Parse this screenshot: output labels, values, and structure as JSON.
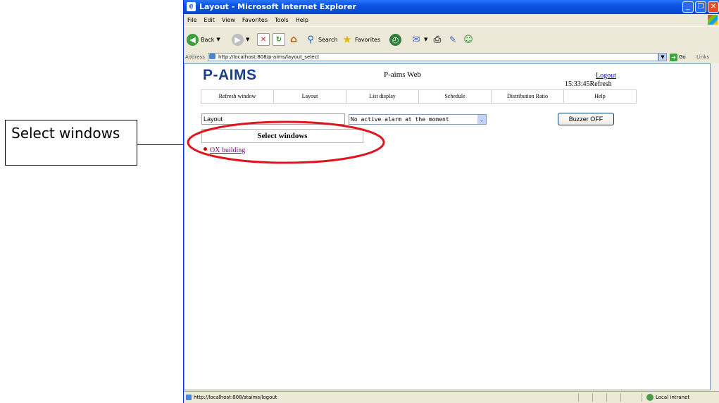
{
  "callout": {
    "text": "Select windows"
  },
  "browser": {
    "title": "Layout - Microsoft Internet Explorer",
    "menu": [
      "File",
      "Edit",
      "View",
      "Favorites",
      "Tools",
      "Help"
    ],
    "toolbar": {
      "back": "Back",
      "search": "Search",
      "favorites": "Favorites"
    },
    "address_label": "Address",
    "address_url": "http://localhost:808/p-aims/layout_select",
    "go": "Go",
    "links": "Links",
    "status_url": "http://localhost:808/staims/logout",
    "status_zone": "Local intranet"
  },
  "page": {
    "logo": "P-AIMS",
    "app_name": "P-aims Web",
    "logout": "Logout",
    "clock": "15:33:45Refresh",
    "nav": [
      "Refresh window",
      "Layout",
      "List display",
      "Schedule",
      "Distribution Ratio",
      "Help"
    ],
    "layout_field": "Layout",
    "alarm_select": "No active alarm at the moment",
    "buzzer_button": "Buzzer OFF",
    "select_windows_title": "Select windows",
    "windows_list": [
      "OX building"
    ]
  },
  "colors": {
    "highlight": "#e0141e",
    "logo": "#1a3f8a",
    "titlebar": "#0a53e0",
    "visited_link": "#800080"
  }
}
